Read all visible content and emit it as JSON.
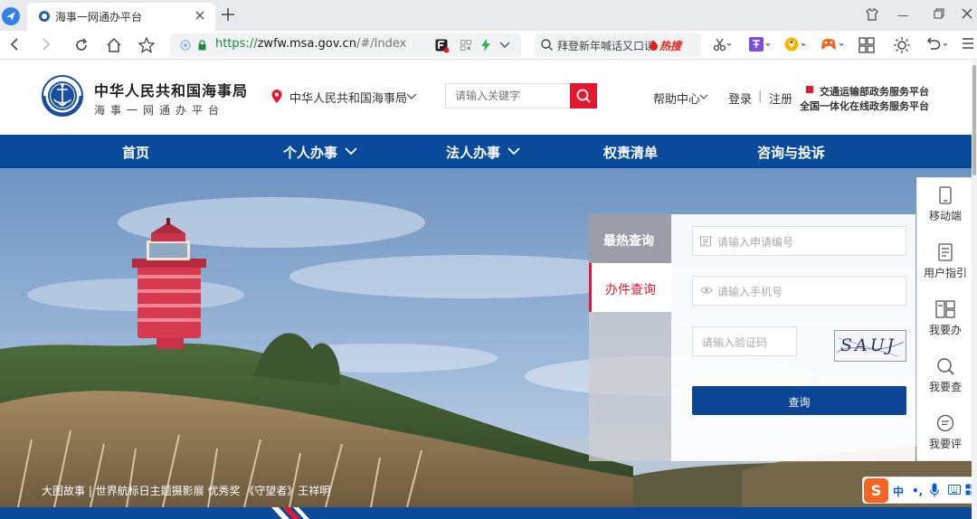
{
  "browser": {
    "tab_title": "海事一网通办平台",
    "url_prefix": "https://",
    "url_host": "zwfw.msa.gov.cn",
    "url_path": "/#/Index",
    "search_text": "拜登新年喊话又口误",
    "search_hot": "热搜"
  },
  "header": {
    "site_name": "中华人民共和国海事局",
    "site_sub": "海事一网通办平台",
    "location": "中华人民共和国海事局",
    "search_placeholder": "请输入关键字",
    "help": "帮助中心",
    "login": "登录",
    "separator": "|",
    "register": "注册",
    "platform_line1": "交通运输部政务服务平台",
    "platform_line2": "全国一体化在线政务服务平台"
  },
  "nav": {
    "items": [
      "首页",
      "个人办事",
      "法人办事",
      "权责清单",
      "咨询与投诉"
    ]
  },
  "hero": {
    "caption": "大图故事 | 世界航标日主题摄影展 优秀奖 《守望者》王祥明"
  },
  "query_panel": {
    "tab_hot": "最热查询",
    "tab_case": "办件查询",
    "app_no_placeholder": "请输入申请编号",
    "phone_placeholder": "请输入手机号",
    "captcha_placeholder": "请输入验证码",
    "captcha_text": "SAUJ",
    "submit": "查询"
  },
  "sidebar": {
    "items": [
      "移动端",
      "用户指引",
      "我要办",
      "我要查",
      "我要评"
    ]
  },
  "ime": {
    "logo": "S",
    "lang": "中"
  },
  "colors": {
    "brand_blue": "#0a4a9a",
    "accent_red": "#e2192e",
    "button_blue": "#0c4596"
  }
}
